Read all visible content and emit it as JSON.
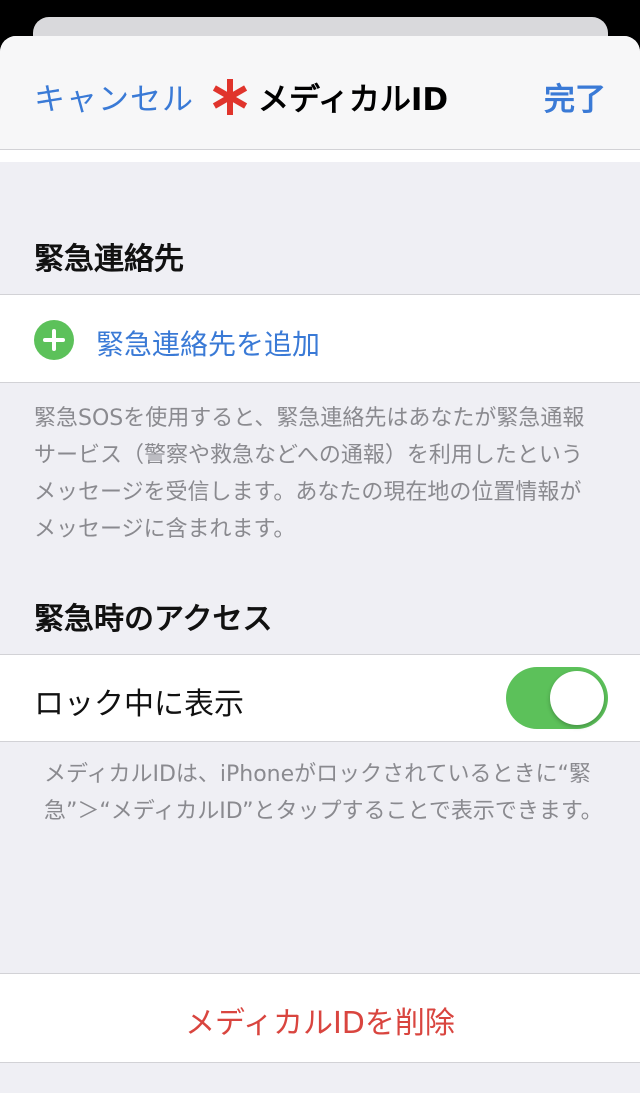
{
  "navbar": {
    "cancel_label": "キャンセル",
    "title": "メディカルID",
    "done_label": "完了",
    "title_icon": "medical-star-icon",
    "title_icon_color": "#e0342c",
    "accent_color": "#3a7ad6"
  },
  "emergency_contacts": {
    "header": "緊急連絡先",
    "add_label": "緊急連絡先を追加",
    "add_icon": "plus-circle-icon",
    "footnote": "緊急SOSを使用すると、緊急連絡先はあなたが緊急通報サービス（警察や救急などへの通報）を利用したというメッセージを受信します。あなたの現在地の位置情報がメッセージに含まれます。"
  },
  "emergency_access": {
    "header": "緊急時のアクセス",
    "toggle_label": "ロック中に表示",
    "toggle_on": true,
    "toggle_color": "#5cc15a",
    "footnote": "メディカルIDは、iPhoneがロックされているときに“緊急”＞“メディカルID”とタップすることで表示できます。"
  },
  "delete": {
    "label": "メディカルIDを削除",
    "color": "#d9453f"
  }
}
